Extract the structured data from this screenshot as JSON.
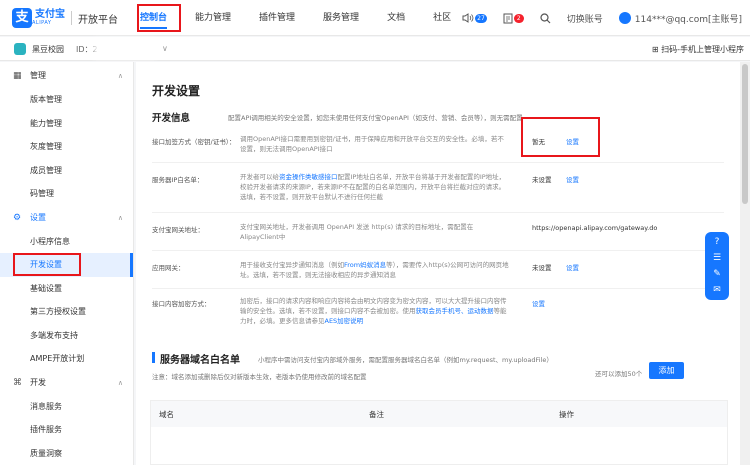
{
  "header": {
    "logo_mark": "支",
    "logo_cn": "支付宝",
    "logo_en": "ALIPAY",
    "platform": "开放平台",
    "nav": [
      "控制台",
      "能力管理",
      "插件管理",
      "服务管理",
      "文档",
      "社区"
    ],
    "volume_badge": "27",
    "msg_badge": "2",
    "switch_account": "切换账号",
    "account": "114***@qq.com[主账号]",
    "accent": "#1677ff"
  },
  "subbar": {
    "app_name": "黑豆校园",
    "app_id": "ID：2C",
    "app_arrow": "∨",
    "scan_text": "扫码-手机上管理小程序"
  },
  "sidebar": {
    "group_manage": "管理",
    "manage_items": [
      "版本管理",
      "能力管理",
      "灰度管理",
      "成员管理",
      "码管理"
    ],
    "group_settings": "设置",
    "settings_items": [
      "小程序信息",
      "开发设置",
      "基础设置",
      "第三方授权设置",
      "多端发布支持",
      "AMPE开放计划"
    ],
    "group_dev": "开发",
    "dev_items": [
      "消息服务",
      "插件服务",
      "质量洞察"
    ]
  },
  "main": {
    "title": "开发设置",
    "section_title": "开发信息",
    "section_desc": "配置API调用相关的安全设置，如您未使用任何支付宝OpenAPI（如支付、营销、会员等），则无需配置",
    "rows": [
      {
        "label": "接口加签方式（密钥/证书）：",
        "desc": "调用OpenAPI接口需要用到密钥/证书，用于保障应用和开放平台交互的安全性。必填，若不设置，则无法调用OpenAPI接口",
        "value": "暂无",
        "link": "设置"
      },
      {
        "label": "服务器IP白名单：",
        "desc_a": "开发者可以给",
        "desc_link": "资金操作类敏感接口",
        "desc_b": "配置IP地址白名单，开放平台将基于开发者配置的IP地址，校验开发者请求的来源IP，若来源IP不在配置的白名单范围内，开放平台将拦截对应的请求。选填，若不设置，则开放平台默认不进行任何拦截",
        "value": "未设置",
        "link": "设置"
      },
      {
        "label": "支付宝网关地址：",
        "desc": "支付宝网关地址，开发者调用 OpenAPI 发送 http(s) 请求的目标地址，需配置在AlipayClient中",
        "value": "https://openapi.alipay.com/gateway.do"
      },
      {
        "label": "应用网关：",
        "desc_a": "用于接收支付宝异步通知消息（例如",
        "desc_link": "From蚂蚁消息",
        "desc_b": "等），需要传入http(s)公网可访问的网页地址。选填，若不设置，则无法接收相应的异步通知消息",
        "value": "未设置",
        "link": "设置"
      },
      {
        "label": "接口内容加密方式：",
        "desc_a": "加密后，接口的请求内容和响应内容将会由明文内容变为密文内容，可以大大提升接口内容传输的安全性。选填，若不设置，则接口内容不会被加密。使用",
        "desc_link": "获取会员手机号、运动数据",
        "desc_b": "等能力时，必填。更多信息请参见",
        "desc_link2": "AES加密说明",
        "link": "设置"
      }
    ],
    "server_title": "服务器域名白名单",
    "server_desc": "小程序中需访问支付宝内部域外服务，需配置服务器域名白名单（例如my.request、my.uploadFile）",
    "server_note": "注意：域名添加或删除后仅对新版本生效，老版本仍使用修改前的域名配置",
    "add_limit": "还可以添加50个",
    "add_button": "添加",
    "table_headers": [
      "域名",
      "备注",
      "操作"
    ]
  },
  "float_bar": [
    "?",
    "☰",
    "✎",
    "✉"
  ]
}
